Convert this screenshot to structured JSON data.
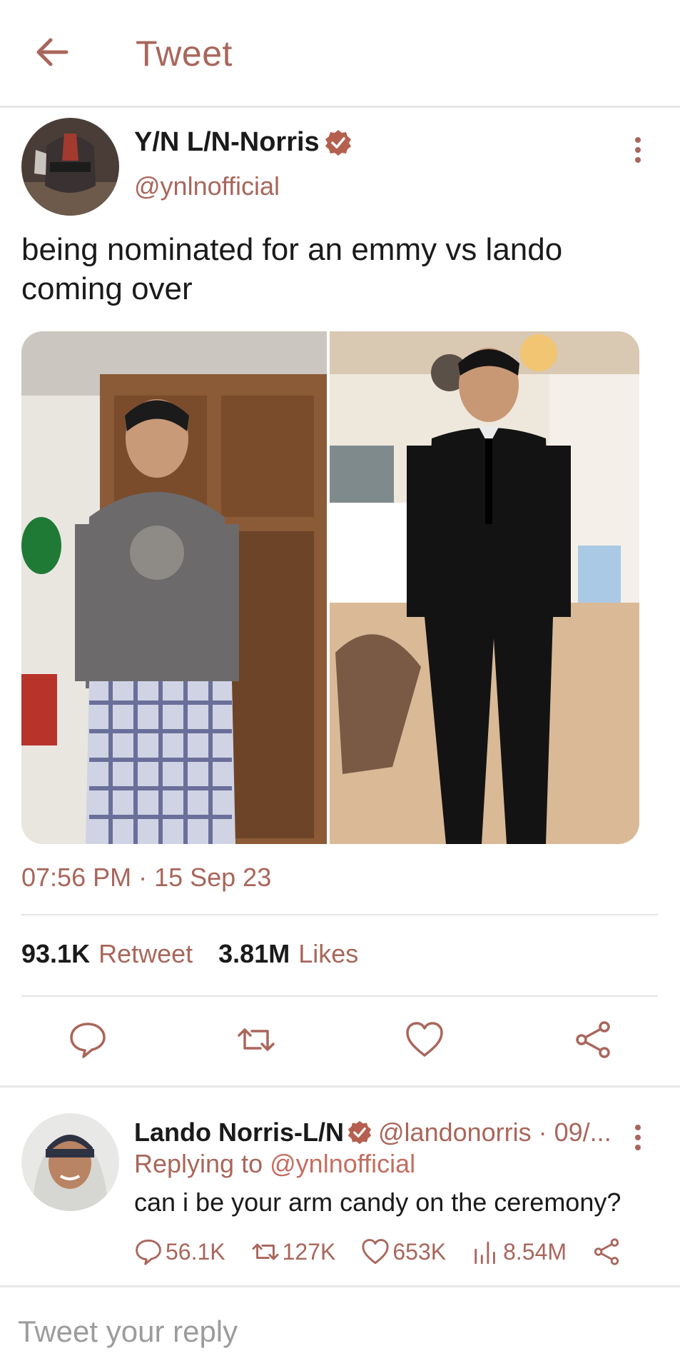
{
  "header": {
    "title": "Tweet"
  },
  "tweet": {
    "author_name": "Y/N L/N-Norris",
    "handle": "@ynlnofficial",
    "text": "being nominated for an emmy vs lando coming over",
    "timestamp": "07:56 PM · 15 Sep 23",
    "retweets": "93.1K",
    "retweets_label": "Retweet",
    "likes": "3.81M",
    "likes_label": "Likes"
  },
  "reply": {
    "author_name": "Lando Norris-L/N",
    "meta": "@landonorris · 09/...",
    "replying_prefix": "Replying to",
    "replying_to": "@ynlnofficial",
    "text": "can i be your arm candy on the ceremony?",
    "comments": "56.1K",
    "retweets": "127K",
    "likes": "653K",
    "views": "8.54M"
  },
  "composer": {
    "placeholder": "Tweet your reply"
  },
  "colors": {
    "accent": "#a9665b",
    "badge": "#b5604f",
    "muted": "#9c9c9c"
  },
  "icons": [
    "back-arrow-icon",
    "verified-badge-icon",
    "more-vertical-icon",
    "reply-icon",
    "retweet-icon",
    "like-icon",
    "share-icon",
    "views-icon"
  ]
}
